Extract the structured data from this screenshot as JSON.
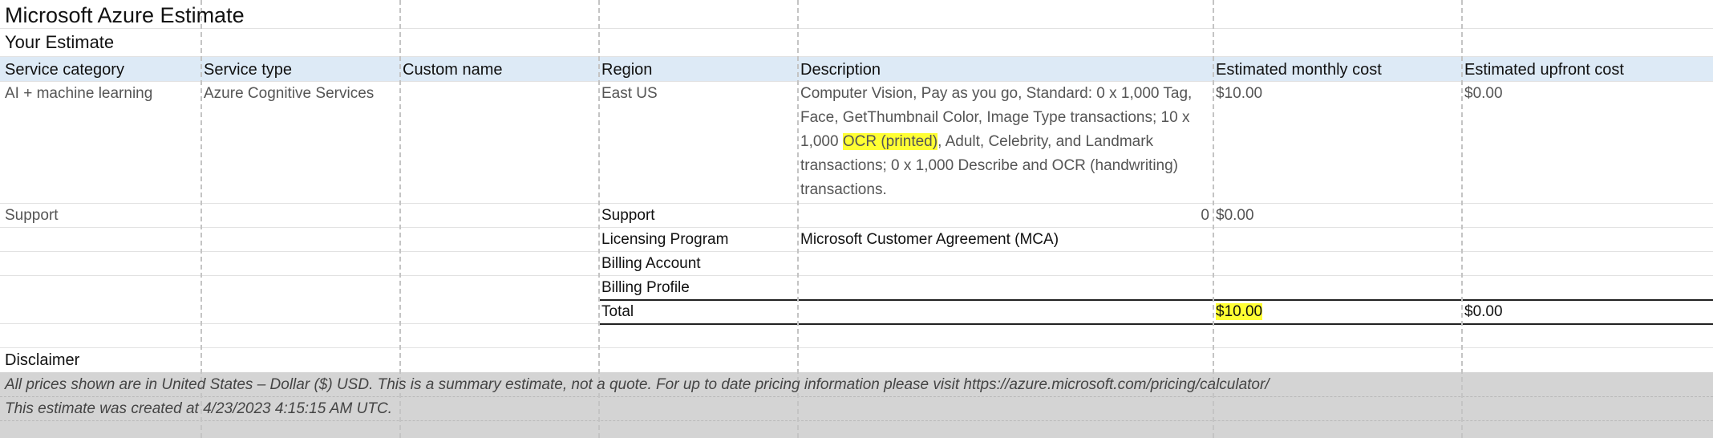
{
  "sheet": {
    "title": "Microsoft Azure Estimate",
    "subtitle": "Your Estimate",
    "headers": [
      "Service category",
      "Service type",
      "Custom name",
      "Region",
      "Description",
      "Estimated monthly cost",
      "Estimated upfront cost"
    ],
    "row1": {
      "category": "AI + machine learning",
      "service_type": "Azure Cognitive Services",
      "custom_name": "",
      "region": "East US",
      "description_part1": "Computer Vision, Pay as you go, Standard: 0 x 1,000 Tag, Face, GetThumbnail Color, Image Type transactions; 10 x 1,000 ",
      "description_highlight": "OCR (printed)",
      "description_part2": ", Adult, Celebrity, and Landmark transactions; 0 x 1,000 Describe and OCR (handwriting) transactions.",
      "monthly": "$10.00",
      "upfront": "$0.00"
    },
    "support": {
      "category": "Support",
      "label": "Support",
      "value": "0",
      "monthly": "$0.00"
    },
    "licensing": {
      "label": "Licensing Program",
      "value": "Microsoft Customer Agreement (MCA)"
    },
    "billing_account": {
      "label": "Billing Account"
    },
    "billing_profile": {
      "label": "Billing Profile"
    },
    "total": {
      "label": "Total",
      "monthly": "$10.00",
      "upfront": "$0.00"
    },
    "disclaimer": {
      "title": "Disclaimer",
      "line1": "All prices shown are in United States – Dollar ($) USD. This is a summary estimate, not a quote. For up to date pricing information please visit https://azure.microsoft.com/pricing/calculator/",
      "line2": "This estimate was created at 4/23/2023 4:15:15 AM UTC."
    },
    "colors": {
      "header_band": "#ddeaf6",
      "highlight": "#ffff33",
      "disclaimer_band": "#d4d4d4"
    }
  }
}
